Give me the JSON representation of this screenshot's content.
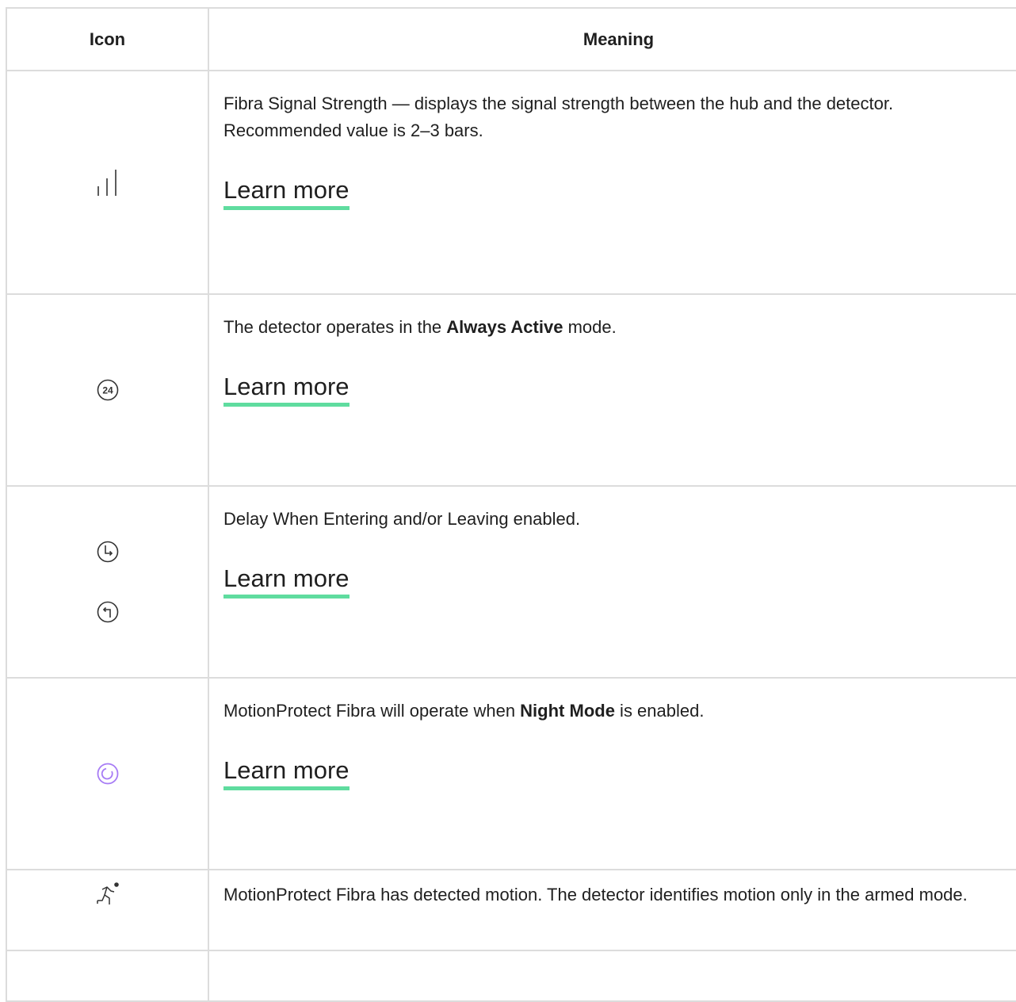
{
  "table": {
    "header_icon": "Icon",
    "header_meaning": "Meaning"
  },
  "rows": [
    {
      "icon": "signal-strength-icon",
      "text": "Fibra Signal Strength — displays the signal strength between the hub and the detector. Recommended value is 2–3 bars.",
      "link": "Learn more"
    },
    {
      "icon": "always-active-24-icon",
      "icon_text": "24",
      "text_before": "The detector operates in the ",
      "text_bold": "Always Active",
      "text_after": " mode.",
      "link": "Learn more"
    },
    {
      "icon": "delay-entering-leaving-icon",
      "text": "Delay When Entering and/or Leaving enabled.",
      "link": "Learn more"
    },
    {
      "icon": "night-mode-icon",
      "text_before": "MotionProtect Fibra will operate when ",
      "text_bold": "Night Mode",
      "text_after": " is enabled.",
      "link": "Learn more"
    },
    {
      "icon": "motion-detected-icon",
      "text": "MotionProtect Fibra has detected motion. The detector identifies motion only in the armed mode."
    }
  ],
  "colors": {
    "border": "#dcdcdc",
    "link_underline": "#5fdc9f",
    "night_mode_icon": "#a77cf5",
    "text": "#1f1f1f"
  }
}
